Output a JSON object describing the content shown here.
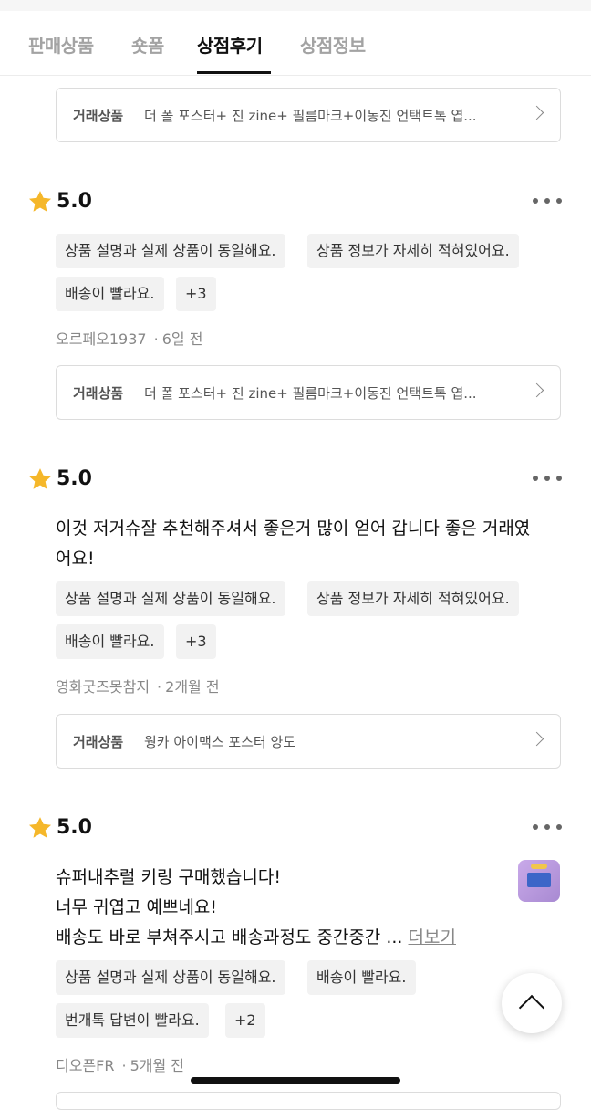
{
  "tabs": [
    {
      "label": "판매상품"
    },
    {
      "label": "숏폼"
    },
    {
      "label": "상점후기"
    },
    {
      "label": "상점정보"
    }
  ],
  "trade_label": "거래상품",
  "top_item": {
    "name": "더 폴 포스터+ 진 zine+ 필름마크+이동진 언택트톡 엽..."
  },
  "reviews": [
    {
      "score": "5.0",
      "text_lines": [],
      "tags": [
        "상품 설명과 실제 상품이 동일해요.",
        "상품 정보가 자세히 적혀있어요.",
        "배송이 빨라요.",
        "+3"
      ],
      "author": "오르페오1937",
      "time": "6일 전",
      "item": "더 폴 포스터+ 진 zine+ 필름마크+이동진 언택트톡 엽..."
    },
    {
      "score": "5.0",
      "text_lines": [
        "이것 저거슈잘 추천해주셔서 좋은거 많이 얻어 갑니다 좋은 거래였",
        "어요!"
      ],
      "tags": [
        "상품 설명과 실제 상품이 동일해요.",
        "상품 정보가 자세히 적혀있어요.",
        "배송이 빨라요.",
        "+3"
      ],
      "author": "영화굿즈못참지",
      "time": "2개월 전",
      "item": "웡카 아이맥스 포스터 양도"
    },
    {
      "score": "5.0",
      "text_lines": [
        "슈퍼내추럴 키링 구매했습니다!",
        "너무 귀엽고 예쁘네요!",
        "배송도 바로 부쳐주시고 배송과정도 중간중간"
      ],
      "ellipsis": "...",
      "more_label": "더보기",
      "tags": [
        "상품 설명과 실제 상품이 동일해요.",
        "배송이 빨라요.",
        "번개톡 답변이 빨라요.",
        "+2"
      ],
      "author": "디오픈FR",
      "time": "5개월 전"
    }
  ],
  "dot_sep": "·",
  "icons": {
    "star": "star-icon",
    "more": "more-icon",
    "chevron": "chevron-right-icon",
    "scroll_top": "chevron-up-icon"
  },
  "colors": {
    "star": "#F5B72A",
    "active_tab": "#111111",
    "inactive_tab": "#A3A3A3"
  }
}
